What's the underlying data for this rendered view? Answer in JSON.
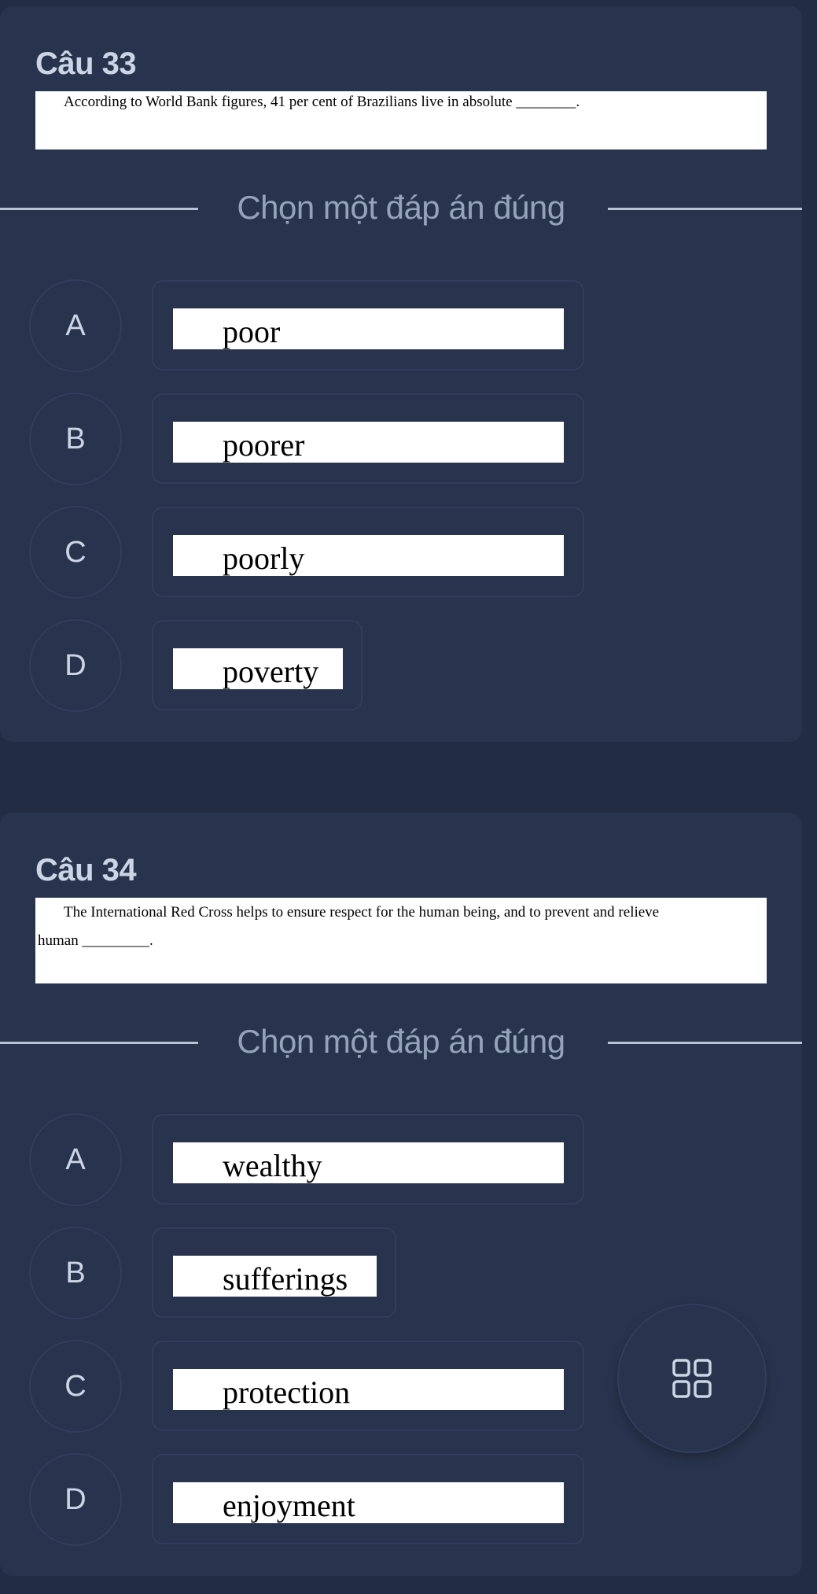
{
  "colors": {
    "page_bg": "#222c45",
    "card_bg": "#28344e",
    "title_text": "#cbd5e4",
    "divider_text": "#94a3ba",
    "divider_line": "#b9c3d6",
    "border": "#313d5a"
  },
  "questions": [
    {
      "title": "Câu 33",
      "prompt_lines": [
        "According to World Bank figures, 41 per cent of Brazilians live in absolute ________."
      ],
      "instruction": "Chọn một đáp án đúng",
      "options": [
        {
          "letter": "A",
          "text": "poor"
        },
        {
          "letter": "B",
          "text": "poorer"
        },
        {
          "letter": "C",
          "text": "poorly"
        },
        {
          "letter": "D",
          "text": "poverty"
        }
      ]
    },
    {
      "title": "Câu 34",
      "prompt_lines": [
        "The International Red Cross helps to ensure respect for the human being, and to prevent and relieve",
        "human _________."
      ],
      "instruction": "Chọn một đáp án đúng",
      "options": [
        {
          "letter": "A",
          "text": "wealthy"
        },
        {
          "letter": "B",
          "text": "sufferings"
        },
        {
          "letter": "C",
          "text": "protection"
        },
        {
          "letter": "D",
          "text": "enjoyment"
        }
      ]
    }
  ],
  "fab": {
    "icon": "grid-icon"
  }
}
